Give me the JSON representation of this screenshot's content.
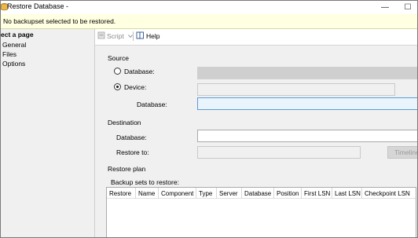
{
  "window": {
    "title": "Restore Database -",
    "minimize_glyph": "—",
    "maximize_glyph": "☐"
  },
  "notification": {
    "message": "No backupset selected to be restored."
  },
  "left_panel": {
    "header": "ect a page",
    "items": [
      {
        "label": "General"
      },
      {
        "label": "Files"
      },
      {
        "label": "Options"
      }
    ]
  },
  "toolbar": {
    "script_label": "Script",
    "help_label": "Help"
  },
  "source": {
    "section_label": "Source",
    "database_radio_label": "Database:",
    "device_radio_label": "Device:",
    "device_value": "",
    "database_label": "Database:",
    "database_value": ""
  },
  "destination": {
    "section_label": "Destination",
    "database_label": "Database:",
    "database_value": "",
    "restore_to_label": "Restore to:",
    "restore_to_value": "",
    "timeline_button_label": "Timeline..."
  },
  "restore_plan": {
    "section_label": "Restore plan",
    "backup_sets_label": "Backup sets to restore:",
    "columns": [
      "Restore",
      "Name",
      "Component",
      "Type",
      "Server",
      "Database",
      "Position",
      "First LSN",
      "Last LSN",
      "Checkpoint LSN"
    ]
  },
  "colors": {
    "notification_bg": "#ffffe1",
    "focused_field_border": "#5a9bd5",
    "disabled_field_bg": "#cfcfcf"
  }
}
